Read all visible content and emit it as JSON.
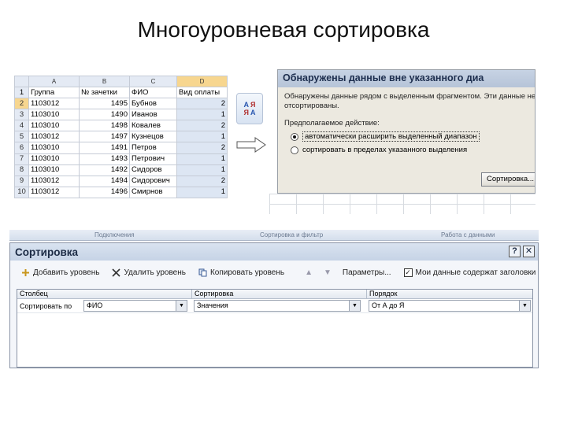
{
  "slide": {
    "title": "Многоуровневая сортировка"
  },
  "sheet": {
    "columns": [
      "",
      "A",
      "B",
      "C",
      "D"
    ],
    "header": {
      "row": "1",
      "cells": [
        "Группа",
        "№ зачетки",
        "ФИО",
        "Вид оплаты"
      ]
    },
    "rows": [
      {
        "n": "2",
        "group": "1103012",
        "id": "1495",
        "name": "Бубнов",
        "pay": "2"
      },
      {
        "n": "3",
        "group": "1103010",
        "id": "1490",
        "name": "Иванов",
        "pay": "1"
      },
      {
        "n": "4",
        "group": "1103010",
        "id": "1498",
        "name": "Ковалев",
        "pay": "2"
      },
      {
        "n": "5",
        "group": "1103012",
        "id": "1497",
        "name": "Кузнецов",
        "pay": "1"
      },
      {
        "n": "6",
        "group": "1103010",
        "id": "1491",
        "name": "Петров",
        "pay": "2"
      },
      {
        "n": "7",
        "group": "1103010",
        "id": "1493",
        "name": "Петрович",
        "pay": "1"
      },
      {
        "n": "8",
        "group": "1103010",
        "id": "1492",
        "name": "Сидоров",
        "pay": "1"
      },
      {
        "n": "9",
        "group": "1103012",
        "id": "1494",
        "name": "Сидорович",
        "pay": "2"
      },
      {
        "n": "10",
        "group": "1103012",
        "id": "1496",
        "name": "Смирнов",
        "pay": "1"
      }
    ]
  },
  "sort_button": {
    "line1a": "А",
    "line1b": "Я",
    "line2a": "Я",
    "line2b": "А"
  },
  "warning": {
    "title": "Обнаружены данные вне указанного диа",
    "message_1": "Обнаружены данные рядом с выделенным фрагментом. Эти данные не",
    "message_2": "отсортированы.",
    "prompt": "Предполагаемое действие:",
    "option_expand": "автоматически расширить выделенный диапазон",
    "option_within": "сортировать в пределах указанного выделения",
    "button": "Сортировка..."
  },
  "ribbon": {
    "t1": "Подключения",
    "t2": "Сортировка и фильтр",
    "t3": "Работа с данными"
  },
  "sort_dialog": {
    "title": "Сортировка",
    "help": "?",
    "close": "✕",
    "toolbar": {
      "add_level": "Добавить уровень",
      "delete_level": "Удалить уровень",
      "copy_level": "Копировать уровень",
      "params": "Параметры...",
      "header_checkbox": "Мои данные содержат заголовки"
    },
    "columns": {
      "column": "Столбец",
      "sort_on": "Сортировка",
      "order": "Порядок"
    },
    "row": {
      "label": "Сортировать по",
      "column_value": "ФИО",
      "sort_on_value": "Значения",
      "order_value": "От А до Я"
    }
  }
}
